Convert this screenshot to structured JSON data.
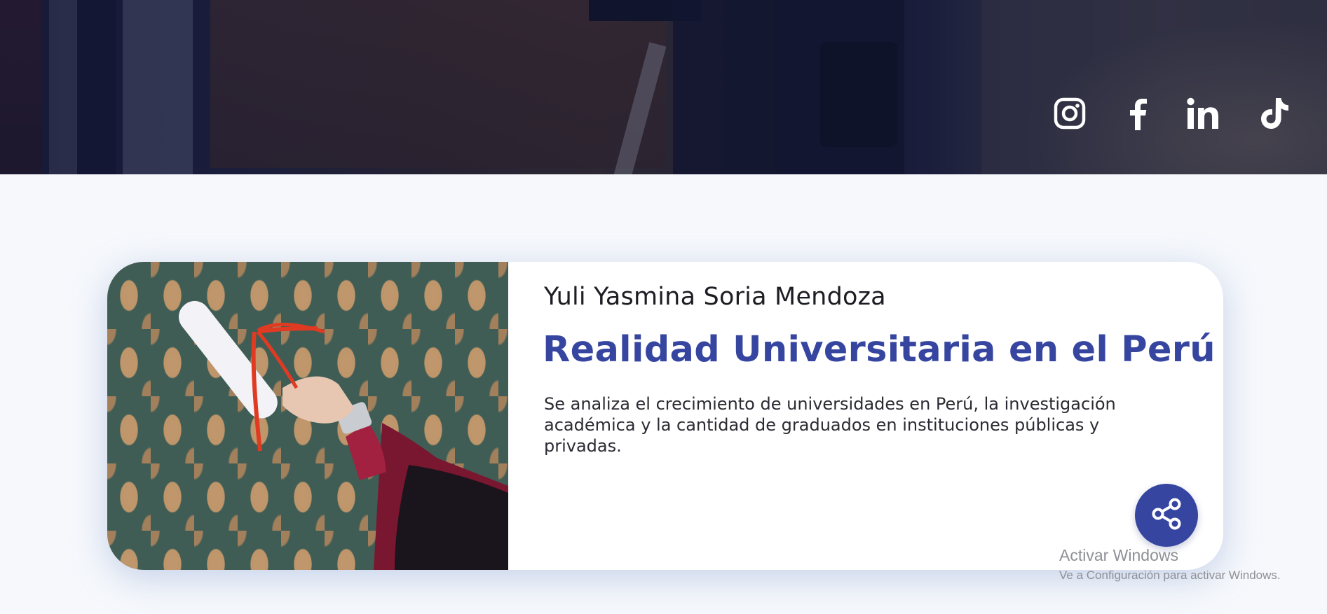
{
  "hero": {
    "social": [
      {
        "name": "instagram",
        "icon": "instagram-icon"
      },
      {
        "name": "facebook",
        "icon": "facebook-icon"
      },
      {
        "name": "linkedin",
        "icon": "linkedin-icon"
      },
      {
        "name": "tiktok",
        "icon": "tiktok-icon"
      }
    ]
  },
  "card": {
    "author": "Yuli Yasmina Soria Mendoza",
    "title": "Realidad Universitaria en el Perú",
    "description": "Se analiza el crecimiento de universidades en Perú, la investigación académica y la cantidad de graduados en instituciones públicas y privadas.",
    "share_icon": "share-icon"
  },
  "windows_watermark": {
    "title": "Activar Windows",
    "subtitle": "Ve a Configuración para activar Windows."
  },
  "colors": {
    "accent": "#3646a0",
    "page_background": "#f6f8fc",
    "card_background": "#ffffff"
  }
}
